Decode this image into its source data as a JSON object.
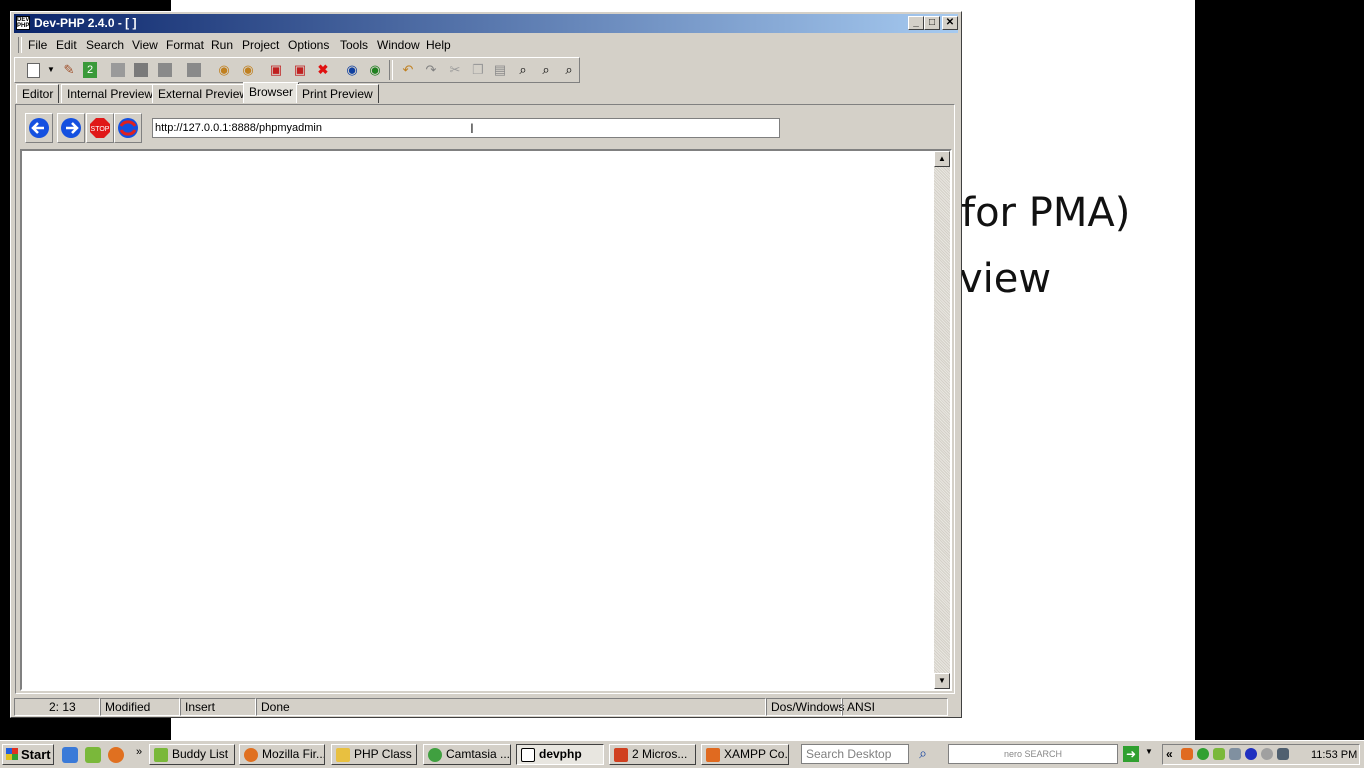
{
  "background_slide": {
    "line1": "for PMA)",
    "line2": "view"
  },
  "window": {
    "title": "Dev-PHP 2.4.0 - [  ]",
    "controls": {
      "minimize": "_",
      "maximize": "□",
      "close": "✕"
    }
  },
  "menu": {
    "items": [
      "File",
      "Edit",
      "Search",
      "View",
      "Format",
      "Run",
      "Project",
      "Options",
      "Tools",
      "Window",
      "Help"
    ]
  },
  "toolbar": {
    "icons": [
      "new-file-icon",
      "open-file-icon",
      "reload-icon",
      "blank-icon",
      "save-icon",
      "save-all-icon",
      "print-icon",
      "find-icon",
      "replace-icon",
      "close-file-icon",
      "close-all-icon",
      "delete-icon",
      "preview-icon",
      "preview-alt-icon",
      "undo-icon",
      "redo-icon",
      "cut-icon",
      "copy-icon",
      "paste-icon",
      "zoom-icon",
      "zoom-in-icon",
      "zoom-out-icon"
    ]
  },
  "tabs": [
    {
      "label": "Editor",
      "active": false
    },
    {
      "label": "Internal Preview",
      "active": false
    },
    {
      "label": "External Preview",
      "active": false
    },
    {
      "label": "Browser",
      "active": true
    },
    {
      "label": "Print Preview",
      "active": false
    }
  ],
  "browser": {
    "url": "http://127.0.0.1:8888/phpmyadmin",
    "stop_label": "STOP"
  },
  "status": {
    "position": "2:  13",
    "modified": "Modified",
    "mode": "Insert",
    "state": "Done",
    "line_ending": "Dos/Windows",
    "encoding": "ANSI"
  },
  "taskbar": {
    "start_label": "Start",
    "chevron": "»",
    "tasks": [
      {
        "label": "Buddy List",
        "active": false
      },
      {
        "label": "Mozilla Fir...",
        "active": false
      },
      {
        "label": "PHP Class",
        "active": false
      },
      {
        "label": "Camtasia ...",
        "active": false
      },
      {
        "label": "devphp",
        "active": true
      },
      {
        "label": "2 Micros...",
        "active": false
      },
      {
        "label": "XAMPP Co...",
        "active": false
      }
    ],
    "search_placeholder": "Search Desktop",
    "nero_label": "nero SEARCH",
    "tray_chevron": "«",
    "clock": "11:53 PM"
  },
  "colors": {
    "title_start": "#0a246a",
    "title_end": "#a6caf0",
    "face": "#d4d0c8"
  }
}
